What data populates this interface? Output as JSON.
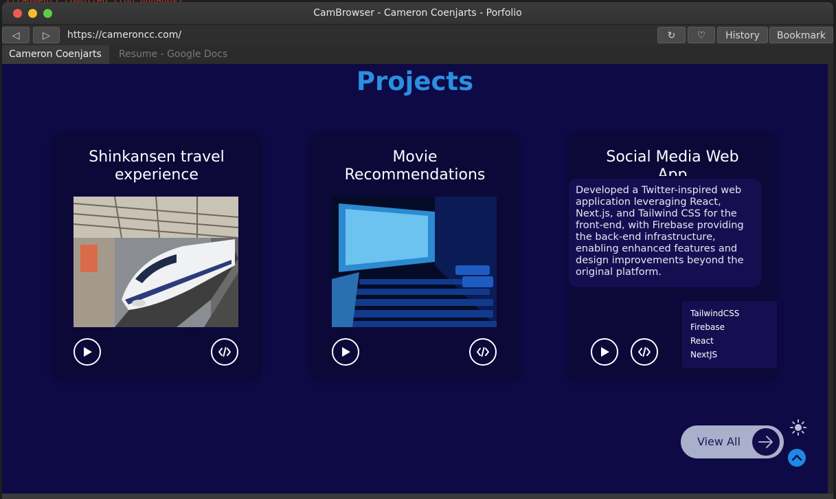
{
  "terminal": {
    "text": "[fragment] compiled (too unhappy)"
  },
  "window": {
    "title": "CamBrowser - Cameron Coenjarts - Porfolio"
  },
  "nav": {
    "back_icon": "◁",
    "forward_icon": "▷",
    "url": "https://cameroncc.com/",
    "reload_icon": "↻",
    "favorite_icon": "♡",
    "history_label": "History",
    "bookmark_label": "Bookmark"
  },
  "tabs": [
    {
      "label": "Cameron Coenjarts -",
      "active": true
    },
    {
      "label": "Resume - Google Docs",
      "active": false
    }
  ],
  "page": {
    "heading": "Projects",
    "projects": [
      {
        "title": "Shinkansen travel experience",
        "image": "shinkansen-train-photo"
      },
      {
        "title": "Movie Recommendations",
        "image": "movie-theater-photo"
      },
      {
        "title": "Social Media Web App",
        "description": "Developed a Twitter-inspired web application leveraging React, Next.js, and Tailwind CSS for the front-end, with Firebase providing the back-end infrastructure, enabling enhanced features and design improvements beyond the original platform.",
        "tags": [
          "TailwindCSS",
          "Firebase",
          "React",
          "NextJS"
        ]
      }
    ],
    "view_all_label": "View All"
  },
  "colors": {
    "page_bg": "#0e0a46",
    "heading": "#2b8fe0",
    "card_bg": "#0c0838",
    "accent_blue": "#1e88e5"
  }
}
